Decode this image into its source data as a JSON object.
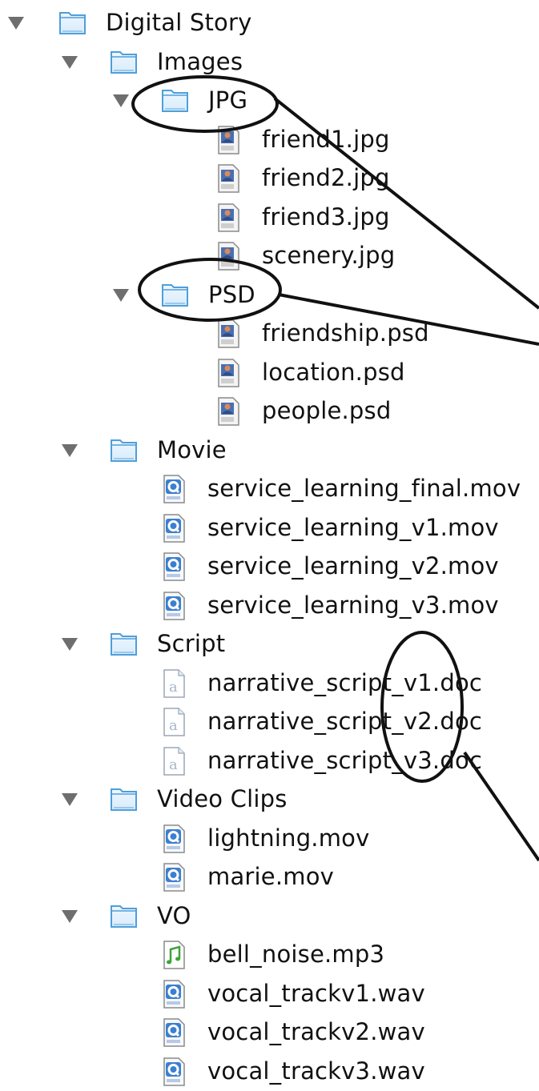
{
  "tree": [
    {
      "label": "Digital Story",
      "kind": "folder",
      "depth": 0,
      "expanded": true
    },
    {
      "label": "Images",
      "kind": "folder",
      "depth": 1,
      "expanded": true
    },
    {
      "label": "JPG",
      "kind": "folder",
      "depth": 2,
      "expanded": true
    },
    {
      "label": "friend1.jpg",
      "kind": "image-file",
      "depth": 3
    },
    {
      "label": "friend2.jpg",
      "kind": "image-file",
      "depth": 3
    },
    {
      "label": "friend3.jpg",
      "kind": "image-file",
      "depth": 3
    },
    {
      "label": "scenery.jpg",
      "kind": "image-file",
      "depth": 3
    },
    {
      "label": "PSD",
      "kind": "folder",
      "depth": 2,
      "expanded": true
    },
    {
      "label": "friendship.psd",
      "kind": "image-file",
      "depth": 3
    },
    {
      "label": "location.psd",
      "kind": "image-file",
      "depth": 3
    },
    {
      "label": "people.psd",
      "kind": "image-file",
      "depth": 3
    },
    {
      "label": "Movie",
      "kind": "folder",
      "depth": 1,
      "expanded": true
    },
    {
      "label": "service_learning_final.mov",
      "kind": "quicktime-file",
      "depth": 2
    },
    {
      "label": "service_learning_v1.mov",
      "kind": "quicktime-file",
      "depth": 2
    },
    {
      "label": "service_learning_v2.mov",
      "kind": "quicktime-file",
      "depth": 2
    },
    {
      "label": "service_learning_v3.mov",
      "kind": "quicktime-file",
      "depth": 2
    },
    {
      "label": "Script",
      "kind": "folder",
      "depth": 1,
      "expanded": true
    },
    {
      "label": "narrative_script_v1.doc",
      "kind": "document-file",
      "depth": 2
    },
    {
      "label": "narrative_script_v2.doc",
      "kind": "document-file",
      "depth": 2
    },
    {
      "label": "narrative_script_v3.doc",
      "kind": "document-file",
      "depth": 2
    },
    {
      "label": "Video Clips",
      "kind": "folder",
      "depth": 1,
      "expanded": true
    },
    {
      "label": "lightning.mov",
      "kind": "quicktime-file",
      "depth": 2
    },
    {
      "label": "marie.mov",
      "kind": "quicktime-file",
      "depth": 2
    },
    {
      "label": "VO",
      "kind": "folder",
      "depth": 1,
      "expanded": true
    },
    {
      "label": "bell_noise.mp3",
      "kind": "audio-file",
      "depth": 2
    },
    {
      "label": "vocal_trackv1.wav",
      "kind": "quicktime-file",
      "depth": 2
    },
    {
      "label": "vocal_trackv2.wav",
      "kind": "quicktime-file",
      "depth": 2
    },
    {
      "label": "vocal_trackv3.wav",
      "kind": "quicktime-file",
      "depth": 2
    }
  ],
  "colors": {
    "folder_light": "#d8ecfb",
    "folder_dark": "#4f9fd9",
    "disclosure": "#6e6e6e",
    "annotation": "#111111",
    "audio_note": "#3aa53a"
  }
}
